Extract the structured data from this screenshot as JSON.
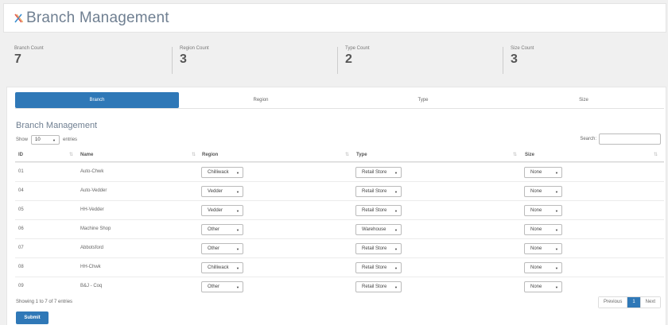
{
  "header": {
    "title": "Branch Management",
    "logo_icon": "x-logo-icon"
  },
  "stats": [
    {
      "label": "Branch Count",
      "value": "7"
    },
    {
      "label": "Region Count",
      "value": "3"
    },
    {
      "label": "Type Count",
      "value": "2"
    },
    {
      "label": "Size Count",
      "value": "3"
    }
  ],
  "tabs": [
    {
      "label": "Branch",
      "active": true
    },
    {
      "label": "Region",
      "active": false
    },
    {
      "label": "Type",
      "active": false
    },
    {
      "label": "Size",
      "active": false
    }
  ],
  "section_title": "Branch Management",
  "length_control": {
    "show_label": "Show",
    "value": "10",
    "entries_label": "entries"
  },
  "search": {
    "label": "Search:",
    "value": ""
  },
  "table": {
    "columns": [
      "ID",
      "Name",
      "Region",
      "Type",
      "Size"
    ],
    "rows": [
      {
        "id": "01",
        "name": "Auto-Chwk",
        "region": "Chilliwack",
        "type": "Retail Store",
        "size": "None"
      },
      {
        "id": "04",
        "name": "Auto-Vedder",
        "region": "Vedder",
        "type": "Retail Store",
        "size": "None"
      },
      {
        "id": "05",
        "name": "HH-Vedder",
        "region": "Vedder",
        "type": "Retail Store",
        "size": "None"
      },
      {
        "id": "06",
        "name": "Machine Shop",
        "region": "Other",
        "type": "Warehouse",
        "size": "None"
      },
      {
        "id": "07",
        "name": "Abbotsford",
        "region": "Other",
        "type": "Retail Store",
        "size": "None"
      },
      {
        "id": "08",
        "name": "HH-Chwk",
        "region": "Chilliwack",
        "type": "Retail Store",
        "size": "None"
      },
      {
        "id": "09",
        "name": "B&J - Coq",
        "region": "Other",
        "type": "Retail Store",
        "size": "None"
      }
    ]
  },
  "info_text": "Showing 1 to 7 of 7 entries",
  "pagination": {
    "previous": "Previous",
    "current": "1",
    "next": "Next"
  },
  "submit_label": "Submit",
  "colors": {
    "accent": "#2f78b7",
    "title": "#6f7f91"
  }
}
